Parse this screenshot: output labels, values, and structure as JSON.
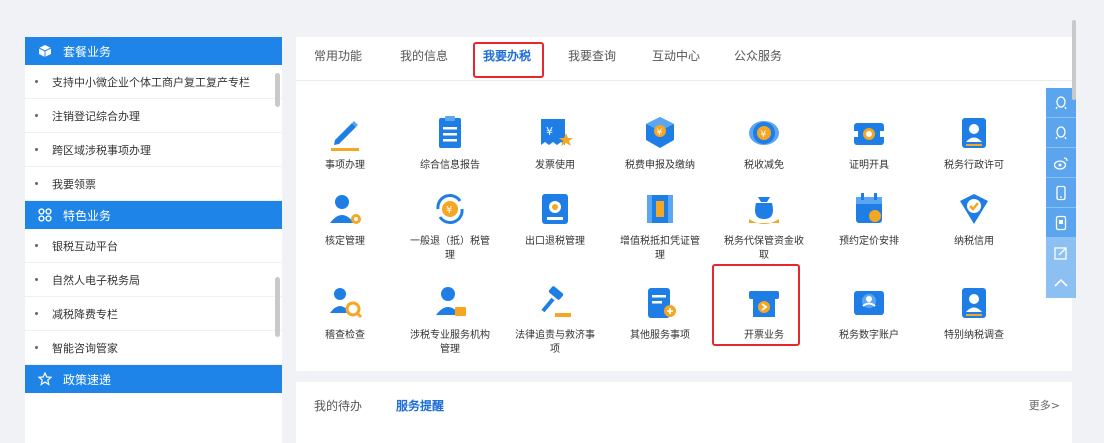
{
  "sidebar": {
    "section1": {
      "title": "套餐业务"
    },
    "items1": [
      "支持中小微企业个体工商户复工复产专栏",
      "注销登记综合办理",
      "跨区域涉税事项办理",
      "我要领票"
    ],
    "section2": {
      "title": "特色业务"
    },
    "items2": [
      "银税互动平台",
      "自然人电子税务局",
      "减税降费专栏",
      "智能咨询管家"
    ],
    "section3": {
      "title": "政策速递"
    }
  },
  "tabs": {
    "common": "常用功能",
    "my_info": "我的信息",
    "tax": "我要办税",
    "query": "我要查询",
    "interact": "互动中心",
    "public": "公众服务",
    "active": "tax"
  },
  "services": [
    {
      "label": "事项办理",
      "icon": "pencil-icon"
    },
    {
      "label": "综合信息报告",
      "icon": "document-icon"
    },
    {
      "label": "发票使用",
      "icon": "invoice-icon"
    },
    {
      "label": "税费申报及缴纳",
      "icon": "tax-declare-icon"
    },
    {
      "label": "税收减免",
      "icon": "coins-icon"
    },
    {
      "label": "证明开具",
      "icon": "certificate-icon"
    },
    {
      "label": "税务行政许可",
      "icon": "person-card-icon"
    },
    {
      "label": "核定管理",
      "icon": "user-gear-icon"
    },
    {
      "label": "一般退（抵）税管理",
      "icon": "refund-icon"
    },
    {
      "label": "出口退税管理",
      "icon": "export-refund-icon"
    },
    {
      "label": "增值税抵扣凭证管理",
      "icon": "voucher-icon"
    },
    {
      "label": "税务代保管资金收取",
      "icon": "money-bag-icon"
    },
    {
      "label": "预约定价安排",
      "icon": "calendar-icon"
    },
    {
      "label": "纳税信用",
      "icon": "credit-shield-icon"
    },
    {
      "label": "稽查检查",
      "icon": "inspect-icon"
    },
    {
      "label": "涉税专业服务机构管理",
      "icon": "agency-icon"
    },
    {
      "label": "法律追责与救济事项",
      "icon": "gavel-icon"
    },
    {
      "label": "其他服务事项",
      "icon": "other-service-icon"
    },
    {
      "label": "开票业务",
      "icon": "invoicing-icon"
    },
    {
      "label": "税务数字账户",
      "icon": "digital-account-icon"
    },
    {
      "label": "特别纳税调查",
      "icon": "special-investigation-icon"
    }
  ],
  "bottom": {
    "todo": "我的待办",
    "reminder": "服务提醒",
    "more": "更多>"
  },
  "floatbar": [
    "qq-icon",
    "qq-icon",
    "weibo-icon",
    "mobile-icon",
    "tablet-icon",
    "edit-icon",
    "scroll-top-icon"
  ],
  "colors": {
    "primary": "#1f84e8",
    "highlight": "#e8262d",
    "icon_blue": "#1f7ee6",
    "icon_orange": "#f5a623"
  }
}
